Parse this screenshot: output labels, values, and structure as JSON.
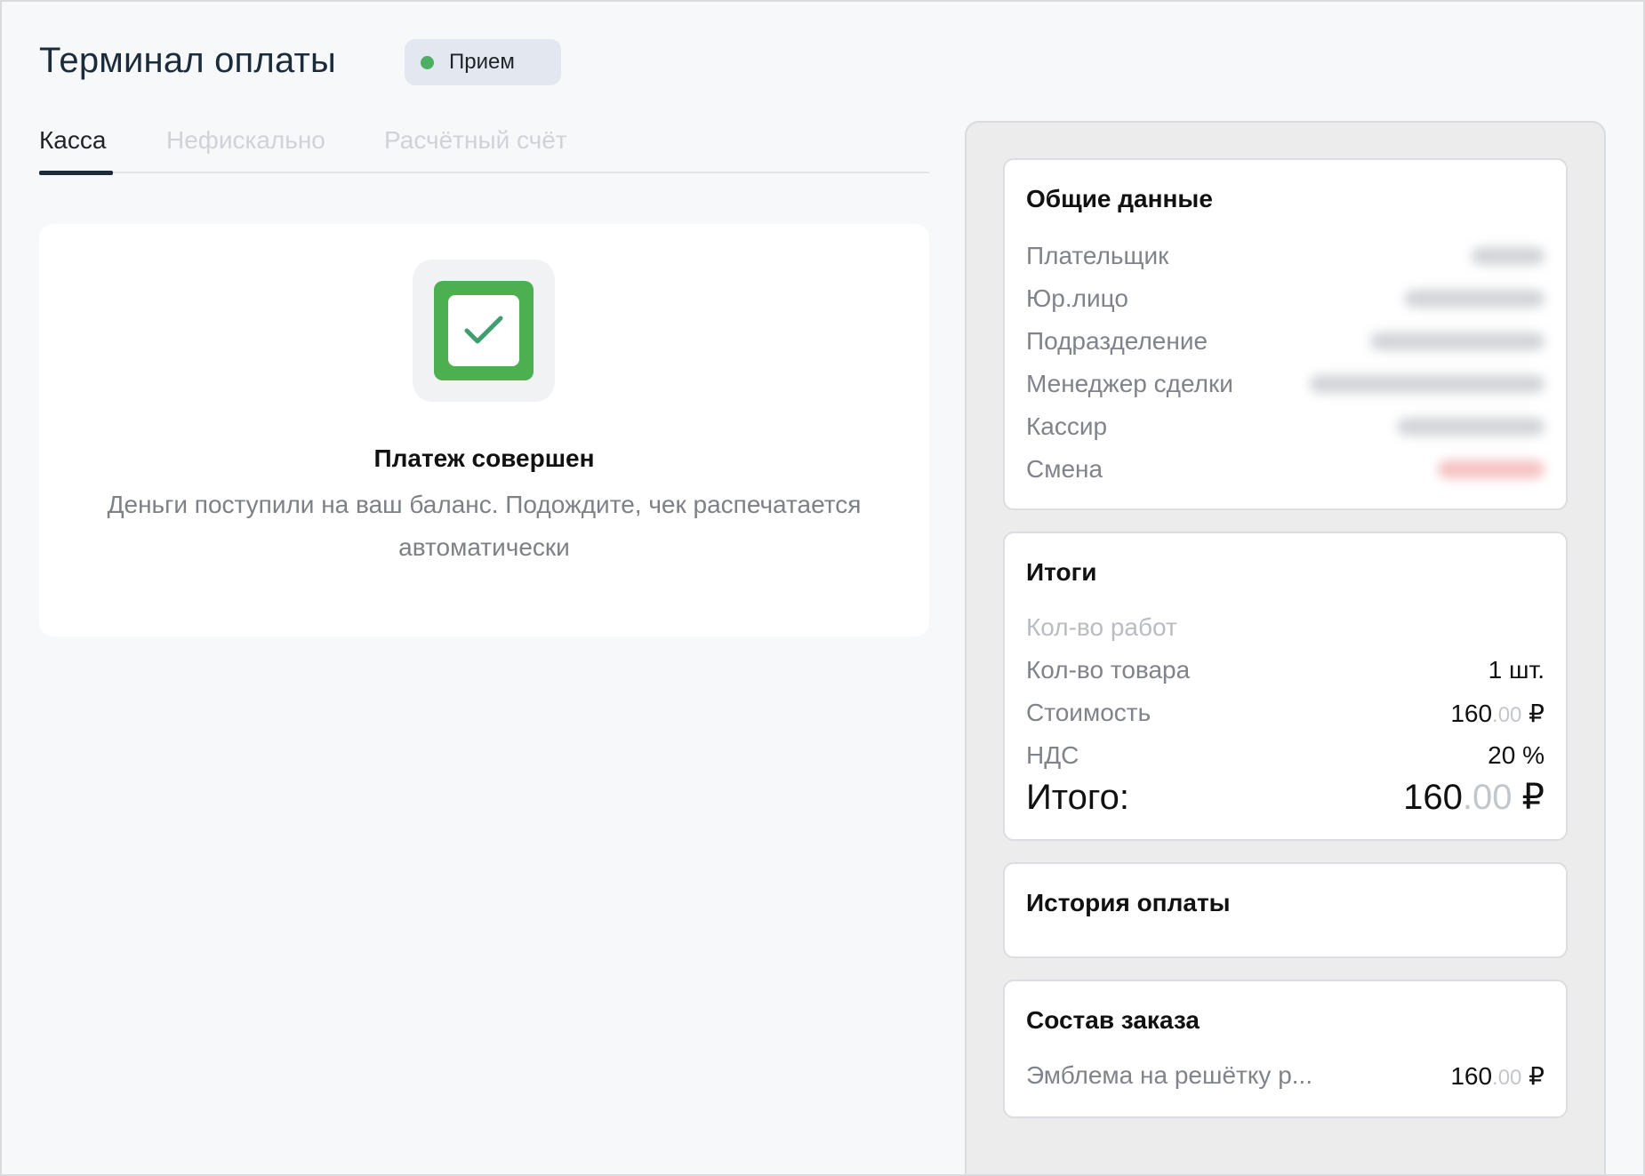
{
  "header": {
    "title": "Терминал оплаты",
    "status": "Прием",
    "status_color": "#4caf62"
  },
  "tabs": [
    {
      "label": "Касса",
      "active": true
    },
    {
      "label": "Нефискально",
      "active": false
    },
    {
      "label": "Расчётный счёт",
      "active": false
    }
  ],
  "success": {
    "icon": "check-icon",
    "icon_color": "#4caf50",
    "title": "Платеж совершен",
    "description": "Деньги поступили на ваш баланс. Подождите, чек распечатается автоматически"
  },
  "general": {
    "title": "Общие данные",
    "rows": [
      {
        "label": "Плательщик"
      },
      {
        "label": "Юр.лицо"
      },
      {
        "label": "Подразделение"
      },
      {
        "label": "Менеджер сделки"
      },
      {
        "label": "Кассир"
      },
      {
        "label": "Смена"
      }
    ]
  },
  "totals": {
    "title": "Итоги",
    "works_label": "Кол-во работ",
    "goods_label": "Кол-во товара",
    "goods_value": "1 шт.",
    "cost_label": "Стоимость",
    "cost_int": "160",
    "cost_dec": ".00",
    "cost_currency": " ₽",
    "vat_label": "НДС",
    "vat_value": "20 %",
    "total_label": "Итого:",
    "total_int": "160",
    "total_dec": ".00",
    "total_currency": " ₽"
  },
  "history": {
    "title": "История оплаты"
  },
  "order": {
    "title": "Состав заказа",
    "item_name": "Эмблема на решётку р...",
    "item_int": "160",
    "item_dec": ".00",
    "item_currency": " ₽"
  }
}
